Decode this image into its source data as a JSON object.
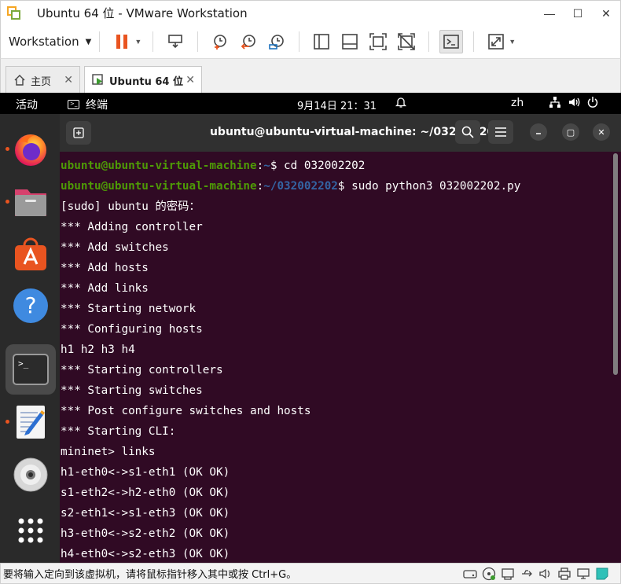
{
  "window": {
    "title": "Ubuntu 64 位 - VMware Workstation",
    "minimize": "—",
    "maximize": "☐",
    "close": "✕"
  },
  "toolbar": {
    "menu_label": "Workstation",
    "menu_caret": "▼",
    "pause_caret": "▼",
    "fullscreen_caret": "▼"
  },
  "tabs": [
    {
      "label": "主页",
      "close": "✕"
    },
    {
      "label": "Ubuntu 64 位",
      "close": "✕"
    }
  ],
  "gnome": {
    "activities": "活动",
    "app_name": "终端",
    "app_icon_glyph": ">_",
    "clock": "9月14日  21：31",
    "lang": "zh"
  },
  "terminal": {
    "title": "ubuntu@ubuntu-virtual-machine: ~/032002202",
    "maximize_glyph": "▢",
    "close_glyph": "✕",
    "lines": [
      {
        "user": "ubuntu@ubuntu-virtual-machine",
        "colon": ":",
        "path": "~",
        "cmd": "$ cd 032002202"
      },
      {
        "user": "ubuntu@ubuntu-virtual-machine",
        "colon": ":",
        "path": "~/032002202",
        "cmd": "$ sudo python3 032002202.py"
      },
      {
        "text": "[sudo] ubuntu 的密码："
      },
      {
        "text": "*** Adding controller"
      },
      {
        "text": "*** Add switches"
      },
      {
        "text": "*** Add hosts"
      },
      {
        "text": "*** Add links"
      },
      {
        "text": "*** Starting network"
      },
      {
        "text": "*** Configuring hosts"
      },
      {
        "text": "h1 h2 h3 h4"
      },
      {
        "text": "*** Starting controllers"
      },
      {
        "text": "*** Starting switches"
      },
      {
        "text": "*** Post configure switches and hosts"
      },
      {
        "text": "*** Starting CLI:"
      },
      {
        "text": "mininet> links"
      },
      {
        "text": "h1-eth0<->s1-eth1 (OK OK)"
      },
      {
        "text": "s1-eth2<->h2-eth0 (OK OK)"
      },
      {
        "text": "s2-eth1<->s1-eth3 (OK OK)"
      },
      {
        "text": "h3-eth0<->s2-eth2 (OK OK)"
      },
      {
        "text": "h4-eth0<->s2-eth3 (OK OK)"
      }
    ]
  },
  "dock": {
    "items": [
      {
        "name": "firefox-icon",
        "running": true,
        "active": false
      },
      {
        "name": "files-icon",
        "running": true,
        "active": false
      },
      {
        "name": "app-center-icon",
        "running": false,
        "active": false
      },
      {
        "name": "help-icon",
        "running": false,
        "active": false
      },
      {
        "name": "terminal-icon",
        "running": true,
        "active": true
      },
      {
        "name": "text-editor-icon",
        "running": true,
        "active": false
      },
      {
        "name": "dvd-icon",
        "running": false,
        "active": false
      },
      {
        "name": "show-apps-icon",
        "running": false,
        "active": false
      }
    ],
    "terminal_glyph": ">_"
  },
  "statusbar": {
    "message": "要将输入定向到该虚拟机，请将鼠标指针移入其中或按 Ctrl+G。"
  },
  "colors": {
    "ubuntu_orange": "#e95420",
    "terminal_bg": "#300a24",
    "prompt_user": "#4e9a06",
    "prompt_path": "#3465a4"
  }
}
